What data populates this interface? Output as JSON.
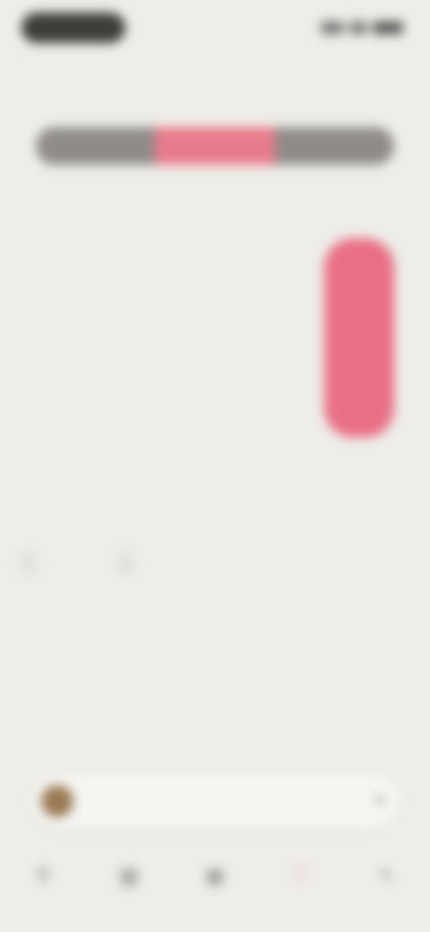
{
  "status_bar": {
    "left": "",
    "right": ""
  },
  "header": {
    "title": ""
  },
  "segmented_control": {
    "items": [
      "",
      "",
      ""
    ],
    "active_index": 1
  },
  "segment_note": "",
  "chart": {
    "y_labels": [
      "",
      ""
    ],
    "days": [
      {
        "label": "",
        "num": ""
      },
      {
        "label": "",
        "num": ""
      },
      {
        "label": "",
        "num": ""
      },
      {
        "label": "",
        "num": ""
      }
    ],
    "highlight_index": 3,
    "bar_color": "#e96f85"
  },
  "section": {
    "title": "",
    "action": "",
    "chips": [
      "",
      ""
    ]
  },
  "rows": [
    {
      "label": "",
      "value": ""
    },
    {
      "label": "",
      "value": ""
    },
    {
      "label": "",
      "value": ""
    }
  ],
  "player": {
    "title": "",
    "control_icon": "menu-icon"
  },
  "tabbar": {
    "items": [
      {
        "icon": "person-icon",
        "label": ""
      },
      {
        "icon": "grid-icon",
        "label": ""
      },
      {
        "icon": "calendar-icon",
        "label": ""
      },
      {
        "icon": "heart-icon",
        "label": ""
      },
      {
        "icon": "more-icon",
        "label": ""
      }
    ],
    "active_index": 3
  },
  "colors": {
    "accent": "#e87b8c",
    "background": "#eeede8",
    "dark": "#3f3d3a"
  }
}
